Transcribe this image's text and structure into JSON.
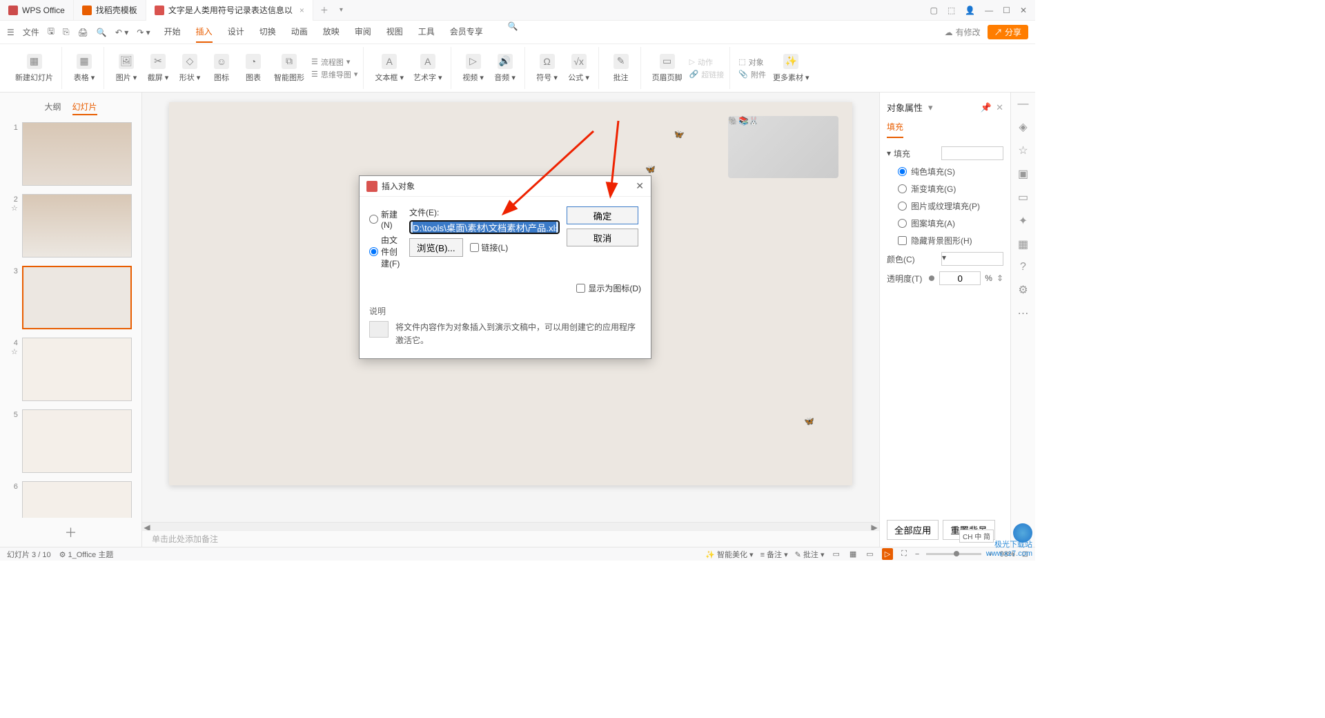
{
  "tabs": {
    "app": "WPS Office",
    "template": "找稻壳模板",
    "document": "文字是人类用符号记录表达信息以"
  },
  "menu": {
    "file": "文件",
    "tabs": [
      "开始",
      "插入",
      "设计",
      "切换",
      "动画",
      "放映",
      "审阅",
      "视图",
      "工具",
      "会员专享"
    ],
    "active": "插入",
    "modify": "有修改",
    "share": "分享"
  },
  "ribbon": {
    "new_slide": "新建幻灯片",
    "table": "表格",
    "picture": "图片",
    "screenshot": "截屏",
    "shapes": "形状",
    "icons": "图标",
    "chart": "图表",
    "smartart": "智能图形",
    "flowchart": "流程图",
    "mindmap": "思维导图",
    "textbox": "文本框",
    "wordart": "艺术字",
    "video": "视频",
    "audio": "音频",
    "symbol": "符号",
    "equation": "公式",
    "comment": "批注",
    "header_footer": "页眉页脚",
    "action": "动作",
    "hyperlink": "超链接",
    "object": "对象",
    "attachment": "附件",
    "more_materials": "更多素材"
  },
  "sidebar": {
    "outline": "大纲",
    "slides": "幻灯片"
  },
  "notes_placeholder": "单击此处添加备注",
  "right_panel": {
    "header": "对象属性",
    "fill_tab": "填充",
    "fill_expand": "填充",
    "solid": "纯色填充(S)",
    "gradient": "渐变填充(G)",
    "pattern": "图片或纹理填充(P)",
    "slide_bg": "图案填充(A)",
    "hide_bg": "隐藏背景图形(H)",
    "color": "颜色(C)",
    "opacity": "透明度(T)",
    "opacity_value": "0",
    "opacity_unit": "%",
    "apply_all": "全部应用",
    "reset_bg": "重置背景"
  },
  "status": {
    "slide_info": "幻灯片 3 / 10",
    "theme": "1_Office 主题",
    "smart_beautify": "智能美化",
    "notes": "备注",
    "comments": "批注",
    "zoom": "98%"
  },
  "dialog": {
    "title": "插入对象",
    "new": "新建(N)",
    "from_file": "由文件创建(F)",
    "file_label": "文件(E):",
    "file_path": "D:\\tools\\桌面\\素材\\文档素材\\产品.xlsx",
    "browse": "浏览(B)...",
    "link": "链接(L)",
    "show_icon": "显示为图标(D)",
    "ok": "确定",
    "cancel": "取消",
    "explain_label": "说明",
    "explain_text": "将文件内容作为对象插入到演示文稿中，可以用创建它的应用程序激活它。"
  },
  "ime": "CH 中 简",
  "watermark_site": "www.xz7.com",
  "watermark_name": "极光下载站"
}
